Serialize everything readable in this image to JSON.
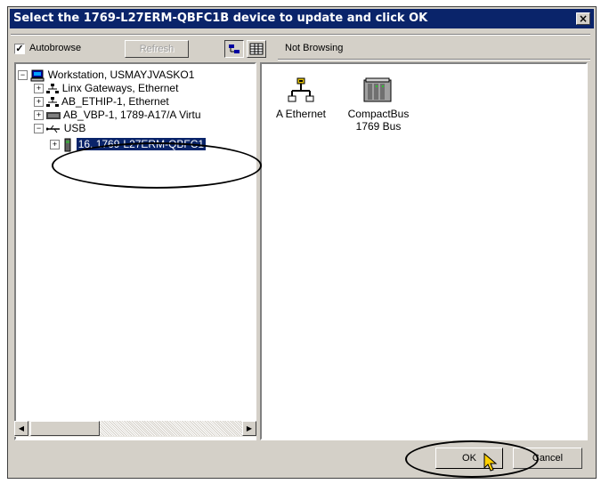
{
  "dialog": {
    "title": "Select the 1769-L27ERM-QBFC1B device to update and click OK",
    "close_glyph": "×"
  },
  "toolbar": {
    "autobrowse_label": "Autobrowse",
    "autobrowse_checked": true,
    "refresh_label": "Refresh",
    "status_text": "Not Browsing"
  },
  "tree": {
    "items": [
      {
        "expander": "−",
        "label": "Workstation, USMAYJVASKO1",
        "icon": "workstation-icon"
      },
      {
        "expander": "+",
        "label": "Linx Gateways, Ethernet",
        "icon": "network-icon"
      },
      {
        "expander": "+",
        "label": "AB_ETHIP-1, Ethernet",
        "icon": "network-icon"
      },
      {
        "expander": "+",
        "label": "AB_VBP-1, 1789-A17/A Virtu",
        "icon": "backplane-icon"
      },
      {
        "expander": "−",
        "label": "USB",
        "icon": "usb-icon"
      },
      {
        "expander": "+",
        "label": "16, 1769-L27ERM-QBFC1",
        "icon": "controller-icon",
        "selected": true
      }
    ]
  },
  "right_panel": {
    "items": [
      {
        "label": "A Ethernet",
        "icon": "network-icon"
      },
      {
        "label": "CompactBus\n1769 Bus",
        "line1": "CompactBus",
        "line2": "1769 Bus",
        "icon": "compactbus-icon"
      }
    ]
  },
  "buttons": {
    "ok_label": "OK",
    "cancel_label": "Cancel"
  },
  "colors": {
    "titlebar": "#0a246a",
    "selection": "#0a246a",
    "face": "#d4d0c8"
  }
}
